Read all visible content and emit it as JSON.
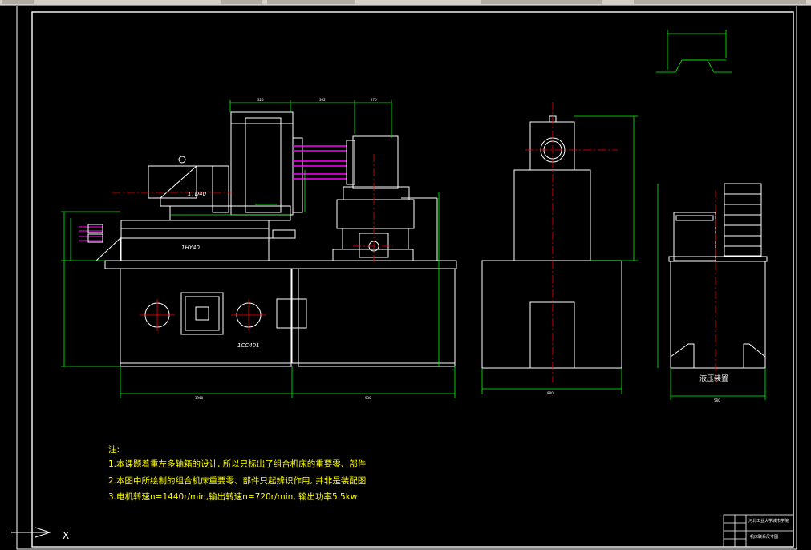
{
  "toolbar": {
    "label": "AutoCAD toolbar strip"
  },
  "drawing": {
    "part_labels": {
      "head_unit": "1TD40",
      "slide_unit": "1HY40",
      "base_unit": "1CC401",
      "hydraulic": "液压装置"
    },
    "notes": {
      "heading": "注:",
      "line1": "1.本课题着重左多轴箱的设计, 所以只标出了组合机床的重要零、部件",
      "line2": "2.本图中所绘制的组合机床重要零、部件只起辨识作用, 并非是装配图",
      "line3": "3.电机转速n=1440r/min,输出转速n=720r/min, 输出功率5.5kw"
    },
    "title_block": {
      "school": "河北工业大学城市学院",
      "drawing_name": "机床联系尺寸图"
    },
    "dimensions": {
      "overall_left": "1960",
      "overall_right": "930",
      "side_width": "980",
      "hyd_width": "580",
      "height_main": "860",
      "top_a": "325",
      "top_b": "362",
      "top_c": "270"
    },
    "ucs": {
      "axis_x": "X"
    }
  },
  "colors": {
    "background": "#000000",
    "geometry": "#ffffff",
    "dimension": "#00ff00",
    "centerline": "#ff0000",
    "notes": "#ffff00",
    "cable": "#ff00ff"
  }
}
